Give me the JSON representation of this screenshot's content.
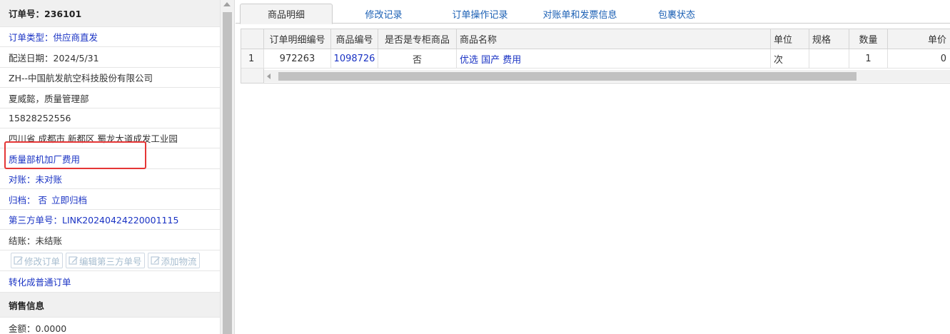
{
  "left_panel": {
    "order_no": "订单号：236101",
    "order_type": "订单类型：供应商直发",
    "delivery_date": "配送日期：2024/5/31",
    "company": "ZH--中国航发航空科技股份有限公司",
    "contact": "夏威懿，质量管理部",
    "phone": "15828252556",
    "address": "四川省 成都市 新都区 蜀龙大道成发工业园",
    "remark": "质量部机加厂费用",
    "reconcile": "对账：未对账",
    "archive_label": "归档：",
    "archive_value": "否",
    "archive_now": "立即归档",
    "third_party_no": "第三方单号：LINK20240424220001115",
    "settlement": "结账：未结账",
    "buttons": {
      "edit_order": "修改订单",
      "edit_third_party": "编辑第三方单号",
      "add_logistics": "添加物流"
    },
    "convert_link": "转化成普通订单",
    "sales_header": "销售信息",
    "amount": "金额：0.0000"
  },
  "tabs": [
    {
      "label": "商品明细",
      "active": true
    },
    {
      "label": "修改记录",
      "active": false
    },
    {
      "label": "订单操作记录",
      "active": false
    },
    {
      "label": "对账单和发票信息",
      "active": false
    },
    {
      "label": "包裹状态",
      "active": false
    }
  ],
  "grid": {
    "columns": [
      "",
      "订单明细编号",
      "商品编号",
      "是否是专柜商品",
      "商品名称",
      "单位",
      "规格",
      "数量",
      "单价"
    ],
    "rows": [
      [
        "1",
        "972263",
        "1098726",
        "否",
        "优选 国产 费用",
        "次",
        "",
        "1",
        "0"
      ]
    ]
  },
  "colors": {
    "link_blue": "#1a33c4",
    "tab_blue": "#1a5fb4",
    "highlight_red": "#e53636"
  }
}
